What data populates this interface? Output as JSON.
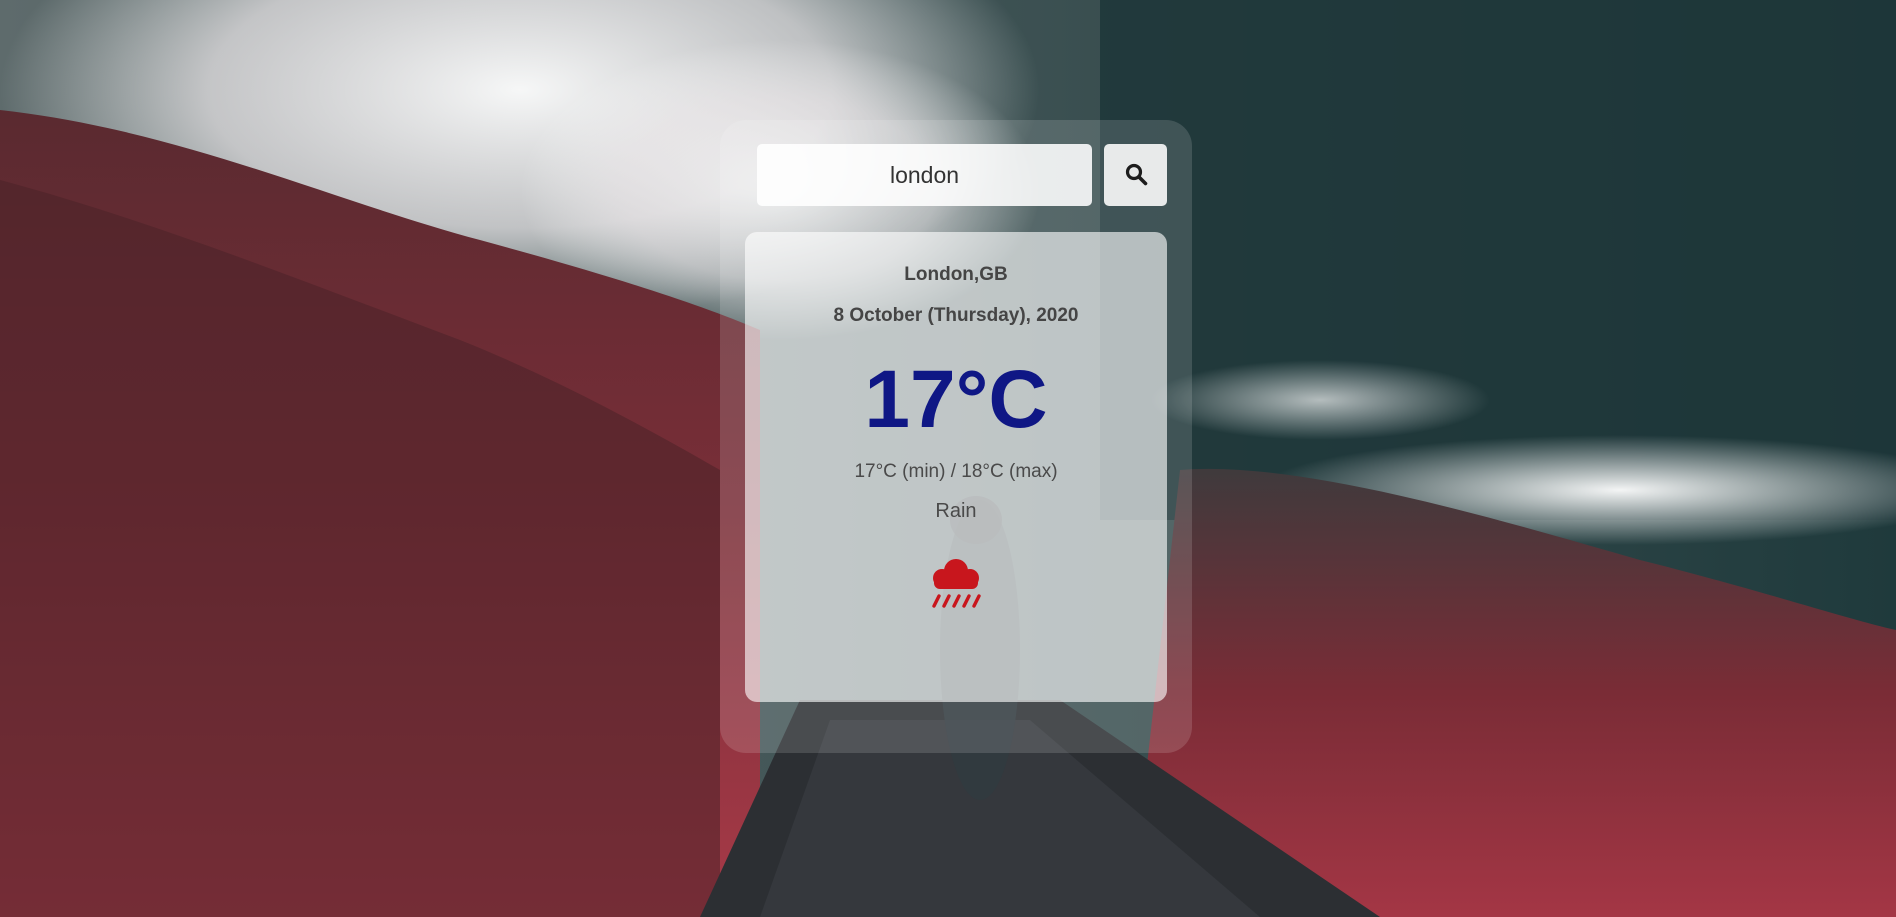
{
  "search": {
    "value": "london",
    "button_icon": "search-icon"
  },
  "weather": {
    "location": "London,GB",
    "date": "8 October (Thursday), 2020",
    "temperature": "17°C",
    "min_max": "17°C (min) / 18°C (max)",
    "condition": "Rain",
    "condition_icon": "rain-cloud-icon"
  },
  "colors": {
    "temperature": "#0f1785",
    "rain_icon": "#c8161d"
  }
}
